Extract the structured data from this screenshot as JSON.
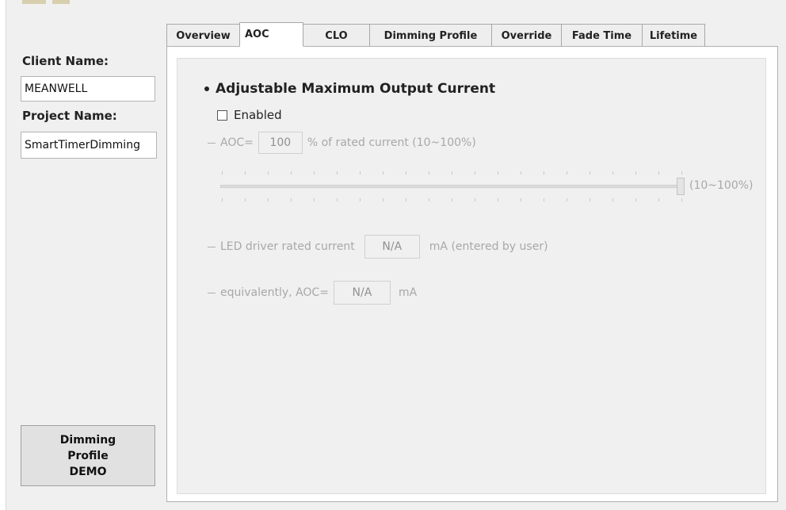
{
  "left_panel": {
    "client_name_label": "Client Name:",
    "client_name_value": "MEANWELL",
    "project_name_label": "Project Name:",
    "project_name_value": "SmartTimerDimming",
    "demo_button_lines": [
      "Dimming",
      "Profile",
      "DEMO"
    ]
  },
  "tabs": [
    {
      "label": "Overview",
      "active": false
    },
    {
      "label": "AOC",
      "active": true
    },
    {
      "label": "CLO",
      "active": false
    },
    {
      "label": "Dimming Profile",
      "active": false
    },
    {
      "label": "Override",
      "active": false
    },
    {
      "label": "Fade Time",
      "active": false
    },
    {
      "label": "Lifetime",
      "active": false
    }
  ],
  "aoc": {
    "heading": "Adjustable Maximum Output Current",
    "enabled_label": "Enabled",
    "enabled_checked": false,
    "aoc_prefix": "AOC=",
    "aoc_value": "100",
    "aoc_suffix": "% of rated current (10~100%)",
    "slider_value_percent": 100,
    "slider_range_label": "(10~100%)",
    "rated_current_label": "LED driver rated current",
    "rated_current_value": "N/A",
    "rated_current_unit": "mA (entered by user)",
    "equiv_label": "equivalently, AOC=",
    "equiv_value": "N/A",
    "equiv_unit": "mA"
  },
  "colors": {
    "disabled_text": "#a8a8a8",
    "window_bg": "#f0f0f0"
  }
}
